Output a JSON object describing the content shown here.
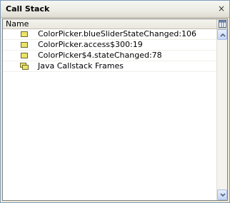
{
  "window": {
    "title": "Call Stack",
    "close_glyph": "×"
  },
  "table": {
    "column_header": "Name",
    "rows": [
      {
        "label": "ColorPicker.blueSliderStateChanged:106",
        "icon": "stack-frame-icon"
      },
      {
        "label": "ColorPicker.access$300:19",
        "icon": "stack-frame-icon"
      },
      {
        "label": "ColorPicker$4.stateChanged:78",
        "icon": "stack-frame-icon"
      },
      {
        "label": "Java Callstack Frames",
        "icon": "stacked-frames-icon"
      }
    ]
  },
  "colors": {
    "frame_icon_fill": "#ece36a",
    "frame_icon_border": "#6b6b2b",
    "scroll_arrow": "#4d6185"
  }
}
